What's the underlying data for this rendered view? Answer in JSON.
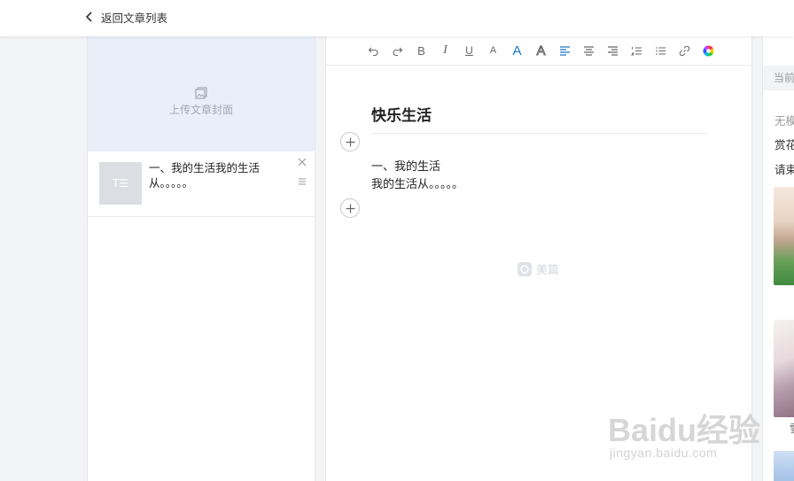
{
  "topbar": {
    "back_label": "返回文章列表"
  },
  "left_panel": {
    "cover_upload_label": "上传文章封面",
    "articles": [
      {
        "thumb_label": "T☰",
        "text": "一、我的生活我的生活从。。。。。"
      }
    ]
  },
  "toolbar": {
    "buttons": [
      {
        "name": "undo-icon"
      },
      {
        "name": "redo-icon"
      },
      {
        "name": "bold-icon",
        "glyph": "B"
      },
      {
        "name": "italic-icon",
        "glyph": "I"
      },
      {
        "name": "underline-icon",
        "glyph": "U"
      },
      {
        "name": "font-size-icon",
        "glyph": "A"
      },
      {
        "name": "font-color-icon",
        "glyph": "A"
      },
      {
        "name": "font-outline-icon",
        "glyph": "A"
      },
      {
        "name": "align-left-icon"
      },
      {
        "name": "align-center-icon"
      },
      {
        "name": "align-right-icon"
      },
      {
        "name": "ordered-list-icon"
      },
      {
        "name": "unordered-list-icon"
      },
      {
        "name": "link-icon"
      },
      {
        "name": "color-wheel-icon"
      }
    ],
    "accent_color": "#1a73c9"
  },
  "editor": {
    "title": "快乐生活",
    "body_line_1": "一、我的生活",
    "body_line_2": "我的生活从。。。。。",
    "watermark_text": "美篇"
  },
  "right_panel": {
    "header": "当前",
    "line_1": "无模",
    "line_2": "赏花",
    "line_3": "请束",
    "caption_2": "雪"
  },
  "baidu_watermark": {
    "main": "Baidu经验",
    "sub": "jingyan.baidu.com"
  }
}
